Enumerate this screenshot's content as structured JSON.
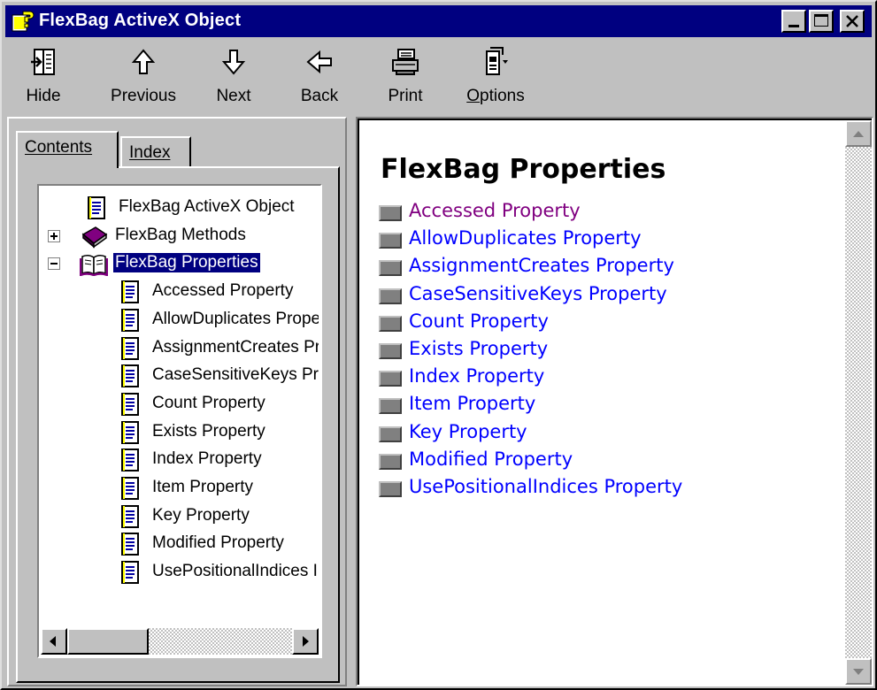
{
  "window": {
    "title": "FlexBag ActiveX Object",
    "title_icon": "help-book-question-icon",
    "controls": [
      "minimize",
      "maximize",
      "close"
    ]
  },
  "toolbar": {
    "items": [
      {
        "label": "Hide",
        "icon": "hide-pane-icon"
      },
      {
        "label": "Previous",
        "icon": "arrow-up-icon"
      },
      {
        "label": "Next",
        "icon": "arrow-down-icon"
      },
      {
        "label": "Back",
        "icon": "arrow-left-icon"
      },
      {
        "label": "Print",
        "icon": "printer-icon"
      },
      {
        "label": "Options",
        "icon": "options-icon",
        "mnemonic": "O"
      }
    ]
  },
  "navigation": {
    "tabs": [
      {
        "label": "Contents",
        "mnemonic": "C",
        "active": true
      },
      {
        "label": "Index",
        "mnemonic": "I",
        "active": false
      }
    ],
    "tree": [
      {
        "label": "FlexBag ActiveX Object",
        "icon": "page-icon",
        "level": 0
      },
      {
        "label": "FlexBag Methods",
        "icon": "closed-book-icon",
        "level": 0,
        "expander": "+"
      },
      {
        "label": "FlexBag Properties",
        "icon": "open-book-icon",
        "level": 0,
        "expander": "-",
        "selected": true
      },
      {
        "label": "Accessed Property",
        "icon": "page-icon",
        "level": 1
      },
      {
        "label": "AllowDuplicates Prope",
        "icon": "page-icon",
        "level": 1
      },
      {
        "label": "AssignmentCreates Pr",
        "icon": "page-icon",
        "level": 1
      },
      {
        "label": "CaseSensitiveKeys Pr",
        "icon": "page-icon",
        "level": 1
      },
      {
        "label": "Count Property",
        "icon": "page-icon",
        "level": 1
      },
      {
        "label": "Exists Property",
        "icon": "page-icon",
        "level": 1
      },
      {
        "label": "Index Property",
        "icon": "page-icon",
        "level": 1
      },
      {
        "label": "Item Property",
        "icon": "page-icon",
        "level": 1
      },
      {
        "label": "Key Property",
        "icon": "page-icon",
        "level": 1
      },
      {
        "label": "Modified Property",
        "icon": "page-icon",
        "level": 1
      },
      {
        "label": "UsePositionalIndices I",
        "icon": "page-icon",
        "level": 1
      }
    ]
  },
  "content": {
    "title": "FlexBag Properties",
    "links": [
      {
        "label": "Accessed Property",
        "visited": true
      },
      {
        "label": "AllowDuplicates Property",
        "visited": false
      },
      {
        "label": "AssignmentCreates Property",
        "visited": false
      },
      {
        "label": "CaseSensitiveKeys Property",
        "visited": false
      },
      {
        "label": "Count Property",
        "visited": false
      },
      {
        "label": "Exists Property",
        "visited": false
      },
      {
        "label": "Index Property",
        "visited": false
      },
      {
        "label": "Item Property",
        "visited": false
      },
      {
        "label": "Key Property",
        "visited": false
      },
      {
        "label": "Modified Property",
        "visited": false
      },
      {
        "label": "UsePositionalIndices Property",
        "visited": false
      }
    ]
  },
  "colors": {
    "titlebar": "#000080",
    "link": "#0000ff",
    "visited_link": "#800080",
    "face": "#c0c0c0"
  }
}
